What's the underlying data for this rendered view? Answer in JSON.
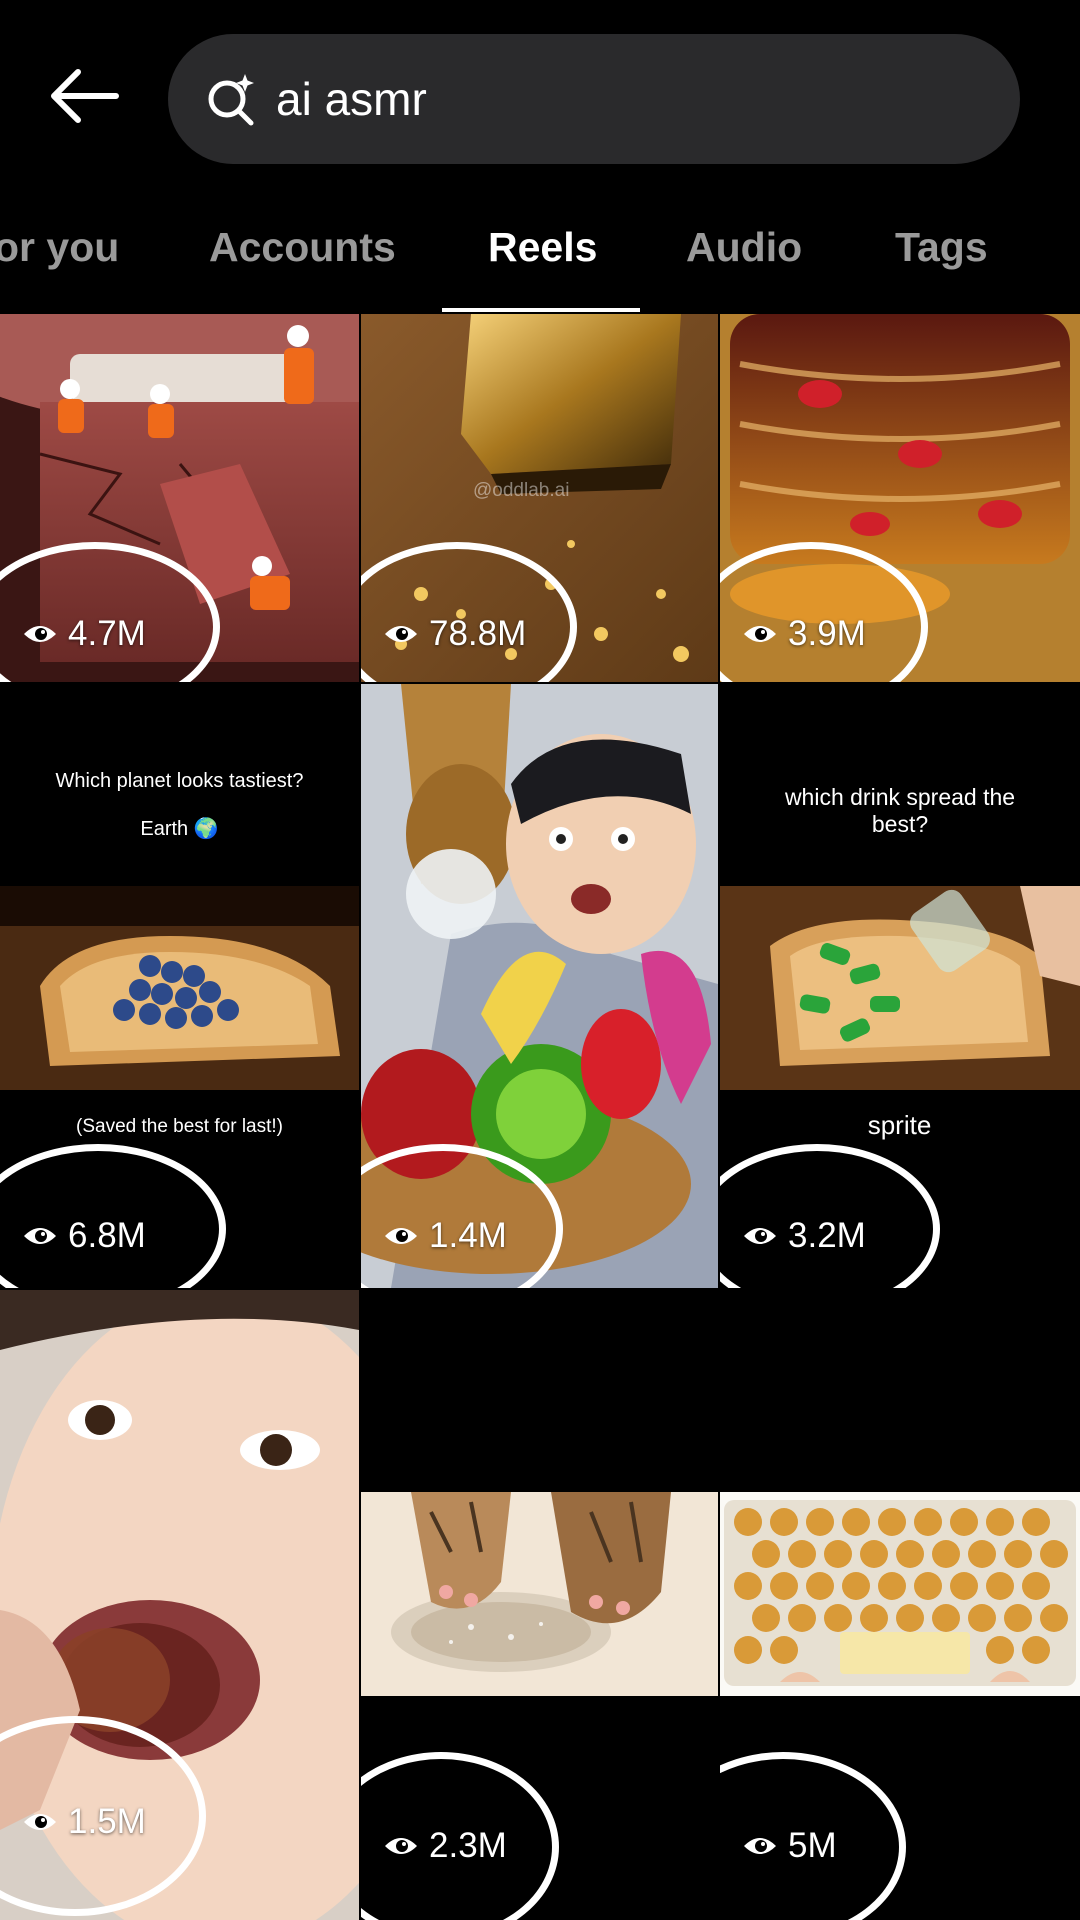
{
  "search": {
    "query": "ai asmr"
  },
  "tabs": [
    {
      "label": "or you"
    },
    {
      "label": "Accounts"
    },
    {
      "label": "Reels"
    },
    {
      "label": "Audio"
    },
    {
      "label": "Tags"
    }
  ],
  "reels": [
    {
      "views": "4.7M"
    },
    {
      "views": "78.8M",
      "watermark": "@oddlab.ai"
    },
    {
      "views": "3.9M"
    },
    {
      "views": "6.8M",
      "caption_top": "Which planet looks tastiest?",
      "caption_sub": "Earth 🌍",
      "caption_bottom": "(Saved the best for last!)"
    },
    {
      "views": "1.4M"
    },
    {
      "views": "3.2M",
      "caption_top": "which drink spread the best?",
      "caption_bottom": "sprite"
    },
    {
      "views": "1.5M"
    },
    {
      "views": "2.3M"
    },
    {
      "views": "5M"
    }
  ],
  "colors": {
    "background": "#000000",
    "search_bg": "#2a2a2c",
    "tab_inactive": "#9a9a9a",
    "accent": "#ffffff"
  }
}
